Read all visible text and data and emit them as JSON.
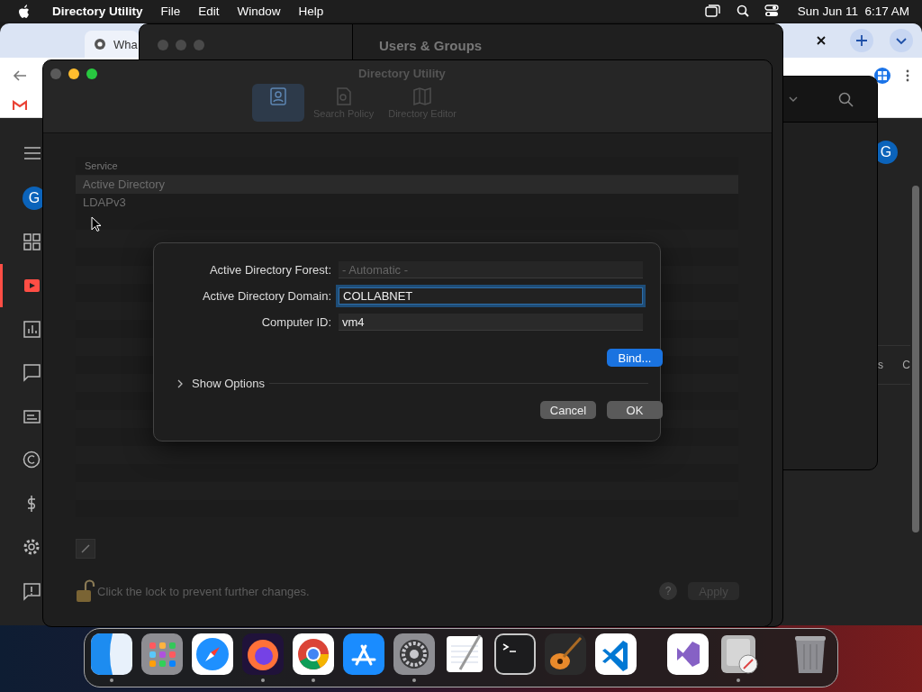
{
  "menu_bar": {
    "app_name": "Directory Utility",
    "menus": [
      "File",
      "Edit",
      "Window",
      "Help"
    ],
    "clock": "Sun Jun 11  6:17 AM"
  },
  "browser": {
    "tab_title": "Wha",
    "avatar": "G",
    "sidebar_avatar": "G",
    "content_fragments": [
      "s",
      "C"
    ]
  },
  "users_groups": {
    "title": "Users & Groups"
  },
  "directory_utility": {
    "title": "Directory Utility",
    "toolbar": [
      {
        "kind": "services",
        "selected": true
      },
      {
        "kind": "search",
        "label": "Search Policy",
        "selected": false
      },
      {
        "kind": "editor",
        "label": "Directory Editor",
        "selected": false
      }
    ],
    "services": {
      "column": "Service",
      "rows": [
        {
          "name": "Active Directory",
          "selected": true
        },
        {
          "name": "LDAPv3",
          "selected": false
        }
      ]
    },
    "lock": {
      "locked": false,
      "message": "Click the lock to prevent further changes."
    },
    "help": "?",
    "apply": {
      "label": "Apply",
      "disabled": true
    }
  },
  "dialog": {
    "fields": [
      {
        "label": "Active Directory Forest:",
        "placeholder": "- Automatic -",
        "disabled": true,
        "focused": false
      },
      {
        "label": "Active Directory Domain:",
        "value": "COLLABNET",
        "disabled": false,
        "focused": true
      },
      {
        "label": "Computer ID:",
        "value": "vm4",
        "focused": false
      }
    ],
    "bind": {
      "label": "Bind...",
      "default": true
    },
    "options": {
      "label": "Show Options",
      "expanded": false
    },
    "buttons": [
      {
        "label": "Cancel",
        "default": false
      },
      {
        "label": "OK",
        "default": false
      }
    ]
  },
  "dock": {
    "items": [
      {
        "kind": "finder",
        "running": true
      },
      {
        "kind": "launchpad",
        "running": false
      },
      {
        "kind": "safari",
        "running": false
      },
      {
        "kind": "firefox",
        "running": true
      },
      {
        "kind": "chrome",
        "running": true
      },
      {
        "kind": "appstore",
        "running": false
      },
      {
        "kind": "settings",
        "running": true
      },
      {
        "kind": "textedit",
        "running": false
      },
      {
        "kind": "terminal",
        "running": false
      },
      {
        "kind": "guitar",
        "running": false
      },
      {
        "kind": "vscode",
        "running": false
      },
      {
        "kind": "separator"
      },
      {
        "kind": "vs",
        "running": false
      },
      {
        "kind": "utility",
        "running": true
      },
      {
        "kind": "separator"
      },
      {
        "kind": "trash",
        "running": false
      }
    ]
  }
}
